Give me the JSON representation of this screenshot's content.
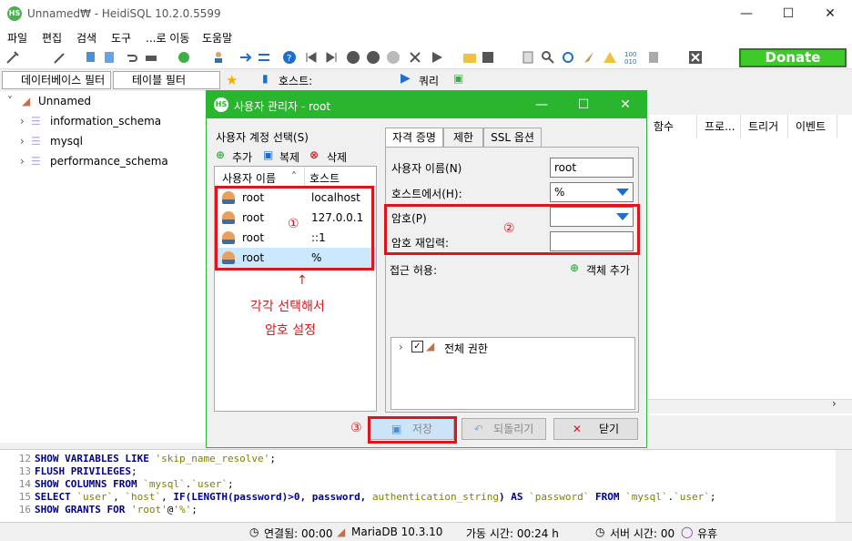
{
  "window": {
    "title": "Unnamed₩ - HeidiSQL 10.2.0.5599",
    "logo": "HS"
  },
  "menu": [
    "파일",
    "편집",
    "검색",
    "도구",
    "...로 이동",
    "도움말"
  ],
  "toolbar": {
    "donate_label": "Donate"
  },
  "filters": {
    "db_filter_placeholder": "데이터베이스 필터",
    "table_filter_placeholder": "테이블 필터",
    "host_label": "호스트:",
    "query_label": "쿼리"
  },
  "tree": {
    "root": "Unnamed",
    "items": [
      "information_schema",
      "mysql",
      "performance_schema"
    ]
  },
  "right_headers": [
    "함수",
    "프로...",
    "트리거",
    "이벤트"
  ],
  "dialog": {
    "title": "사용자 관리자 - root",
    "select_label": "사용자 계정 선택(S)",
    "add_label": "추가",
    "clone_label": "복제",
    "delete_label": "삭제",
    "col_user": "사용자 이름",
    "col_host": "호스트",
    "users": [
      {
        "name": "root",
        "host": "localhost"
      },
      {
        "name": "root",
        "host": "127.0.0.1"
      },
      {
        "name": "root",
        "host": "::1"
      },
      {
        "name": "root",
        "host": "%"
      }
    ],
    "tabs": [
      "자격 증명",
      "제한",
      "SSL 옵션"
    ],
    "username_label": "사용자 이름(N)",
    "username_value": "root",
    "fromhost_label": "호스트에서(H):",
    "fromhost_value": "%",
    "password_label": "암호(P)",
    "password_value": "",
    "repeat_label": "암호 재입력:",
    "repeat_value": "",
    "access_label": "접근 허용:",
    "add_object_label": "객체 추가",
    "all_priv_label": "전체 권한",
    "save_label": "저장",
    "revert_label": "되돌리기",
    "close_label": "닫기"
  },
  "annotations": {
    "c1": "①",
    "c2": "②",
    "c3": "③",
    "arrow": "↑",
    "note_line1": "각각 선택해서",
    "note_line2": "암호 설정"
  },
  "sql": [
    {
      "n": "12",
      "code": "SHOW VARIABLES LIKE 'skip_name_resolve';"
    },
    {
      "n": "13",
      "code": "FLUSH PRIVILEGES;"
    },
    {
      "n": "14",
      "code": "SHOW COLUMNS FROM `mysql`.`user`;"
    },
    {
      "n": "15",
      "code": "SELECT `user`, `host`, IF(LENGTH(password)>0, password, authentication_string) AS `password` FROM `mysql`.`user`;"
    },
    {
      "n": "16",
      "code": "SHOW GRANTS FOR 'root'@'%';"
    }
  ],
  "status": {
    "connected": "연결됨: 00:00",
    "server": "MariaDB 10.3.10",
    "uptime": "가동 시간: 00:24 h",
    "server_time": "서버 시간: 00",
    "idle": "유휴"
  }
}
